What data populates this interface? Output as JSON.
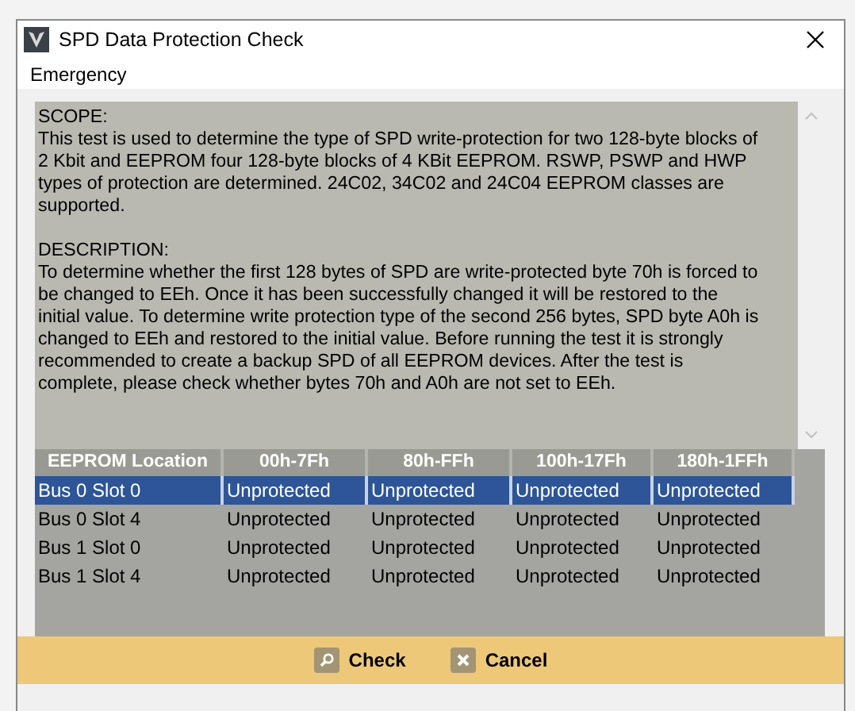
{
  "window": {
    "title": "SPD Data Protection Check"
  },
  "menu": [
    "Emergency"
  ],
  "description": [
    {
      "heading": "SCOPE:",
      "body": "This test is used to determine the type of SPD write-protection for two 128-byte blocks of 2 Kbit and EEPROM four 128-byte blocks of 4 KBit EEPROM. RSWP, PSWP and HWP types of protection are determined. 24C02, 34C02 and 24C04 EEPROM classes are supported."
    },
    {
      "heading": "DESCRIPTION:",
      "body": "To determine whether the first 128 bytes of SPD are write-protected byte 70h is forced to be changed to EEh. Once it has been successfully changed it will be restored to the initial value. To determine write protection type of the second 256 bytes, SPD byte A0h is changed to EEh and restored to the initial value. Before running the test it is strongly recommended to create a backup SPD of all EEPROM devices. After the test is complete, please check whether bytes 70h and A0h are not set to EEh."
    }
  ],
  "table": {
    "columns": [
      "EEPROM Location",
      "00h-7Fh",
      "80h-FFh",
      "100h-17Fh",
      "180h-1FFh"
    ],
    "rows": [
      {
        "cells": [
          "Bus 0 Slot 0",
          "Unprotected",
          "Unprotected",
          "Unprotected",
          "Unprotected"
        ],
        "selected": true
      },
      {
        "cells": [
          "Bus 0 Slot 4",
          "Unprotected",
          "Unprotected",
          "Unprotected",
          "Unprotected"
        ],
        "selected": false
      },
      {
        "cells": [
          "Bus 1 Slot 0",
          "Unprotected",
          "Unprotected",
          "Unprotected",
          "Unprotected"
        ],
        "selected": false
      },
      {
        "cells": [
          "Bus 1 Slot 4",
          "Unprotected",
          "Unprotected",
          "Unprotected",
          "Unprotected"
        ],
        "selected": false
      }
    ]
  },
  "buttons": [
    {
      "kind": "check",
      "label": "Check"
    },
    {
      "kind": "cancel",
      "label": "Cancel"
    }
  ]
}
